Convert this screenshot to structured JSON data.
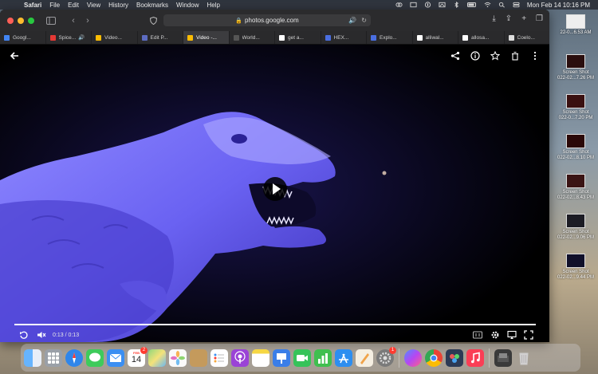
{
  "menubar": {
    "app_name": "Safari",
    "items": [
      "File",
      "Edit",
      "View",
      "History",
      "Bookmarks",
      "Window",
      "Help"
    ],
    "clock": "Mon Feb 14  10:16 PM",
    "status_icons": [
      "creative-cloud-icon",
      "screen-record-icon",
      "1password-icon",
      "wallpaper-icon",
      "bluetooth-icon",
      "battery-icon",
      "wifi-icon",
      "search-icon",
      "control-center-icon"
    ]
  },
  "browser": {
    "url": "photos.google.com",
    "tabs": [
      {
        "label": "Googl...",
        "favicon_color": "#4285f4"
      },
      {
        "label": "Spice...",
        "favicon_color": "#e53935",
        "speaker": "🔊"
      },
      {
        "label": "Video...",
        "favicon_color": "#fbbc04"
      },
      {
        "label": "Edit P...",
        "favicon_color": "#5c6bc0"
      },
      {
        "label": "Video -...",
        "favicon_color": "#fbbc04",
        "active": true
      },
      {
        "label": "World...",
        "favicon_color": "#555555"
      },
      {
        "label": "get a...",
        "favicon_color": "#ffffff"
      },
      {
        "label": "HEX...",
        "favicon_color": "#4a6ee0"
      },
      {
        "label": "Explo...",
        "favicon_color": "#4a6ee0"
      },
      {
        "label": "alliwal...",
        "favicon_color": "#ffffff"
      },
      {
        "label": "allosa...",
        "favicon_color": "#ffffff"
      },
      {
        "label": "Coelo...",
        "favicon_color": "#dddddd"
      }
    ]
  },
  "player": {
    "time_display": "0:13 / 0:13",
    "progress_fraction": 1.0,
    "top_icons": [
      "back-arrow-icon",
      "share-icon",
      "info-icon",
      "star-icon",
      "trash-icon",
      "more-vert-icon"
    ],
    "bottom_icons": [
      "replay-icon",
      "mute-icon",
      "captions-icon",
      "settings-icon",
      "airplay-icon",
      "fullscreen-icon"
    ]
  },
  "desktop": {
    "items": [
      {
        "line1": "",
        "line2": "22-0...6.53 AM"
      },
      {
        "line1": "Screen Shot",
        "line2": "022-02...7.26 PM"
      },
      {
        "line1": "Screen Shot",
        "line2": "022-0...7.20 PM"
      },
      {
        "line1": "Screen Shot",
        "line2": "022-02...8.10 PM"
      },
      {
        "line1": "Screen Shot",
        "line2": "022-02...8.43 PM"
      },
      {
        "line1": "Screen Shot",
        "line2": "022-02...9.06 PM"
      },
      {
        "line1": "Screen Shot",
        "line2": "022-02...9.44 PM"
      }
    ]
  },
  "dock": {
    "calendar_month": "FEB",
    "calendar_day": "14",
    "calendar_badge": "2",
    "settings_badge": "1",
    "apps": [
      {
        "name": "finder",
        "color": "#3d8ef0"
      },
      {
        "name": "launchpad",
        "color": "#8a8a8a"
      },
      {
        "name": "safari",
        "color": "#2f86ea"
      },
      {
        "name": "messages",
        "color": "#3ecb5b"
      },
      {
        "name": "mail",
        "color": "#3b8ff2"
      },
      {
        "name": "calendar",
        "color": "#ffffff"
      },
      {
        "name": "maps",
        "color": "#5fbf62"
      },
      {
        "name": "photos",
        "color": "#f7f7f7"
      },
      {
        "name": "contacts",
        "color": "#c49a5c"
      },
      {
        "name": "reminders",
        "color": "#ffffff"
      },
      {
        "name": "podcasts",
        "color": "#9a43d6"
      },
      {
        "name": "notes",
        "color": "#f6d743"
      },
      {
        "name": "keynote",
        "color": "#3a7ee8"
      },
      {
        "name": "facetime",
        "color": "#36c359"
      },
      {
        "name": "numbers",
        "color": "#3fbf4f"
      },
      {
        "name": "app-store",
        "color": "#2d8ef0"
      },
      {
        "name": "pages",
        "color": "#f0a34a"
      },
      {
        "name": "system-preferences",
        "color": "#7a7a7a"
      },
      {
        "name": "messenger",
        "color": "#8a56f2"
      },
      {
        "name": "chrome",
        "color": "#e8e8e8"
      },
      {
        "name": "davinci-resolve",
        "color": "#2c3a55"
      },
      {
        "name": "music",
        "color": "#fa3e55"
      },
      {
        "name": "recent-folder",
        "color": "#444444"
      },
      {
        "name": "trash",
        "color": "#b8b8b8"
      }
    ]
  }
}
